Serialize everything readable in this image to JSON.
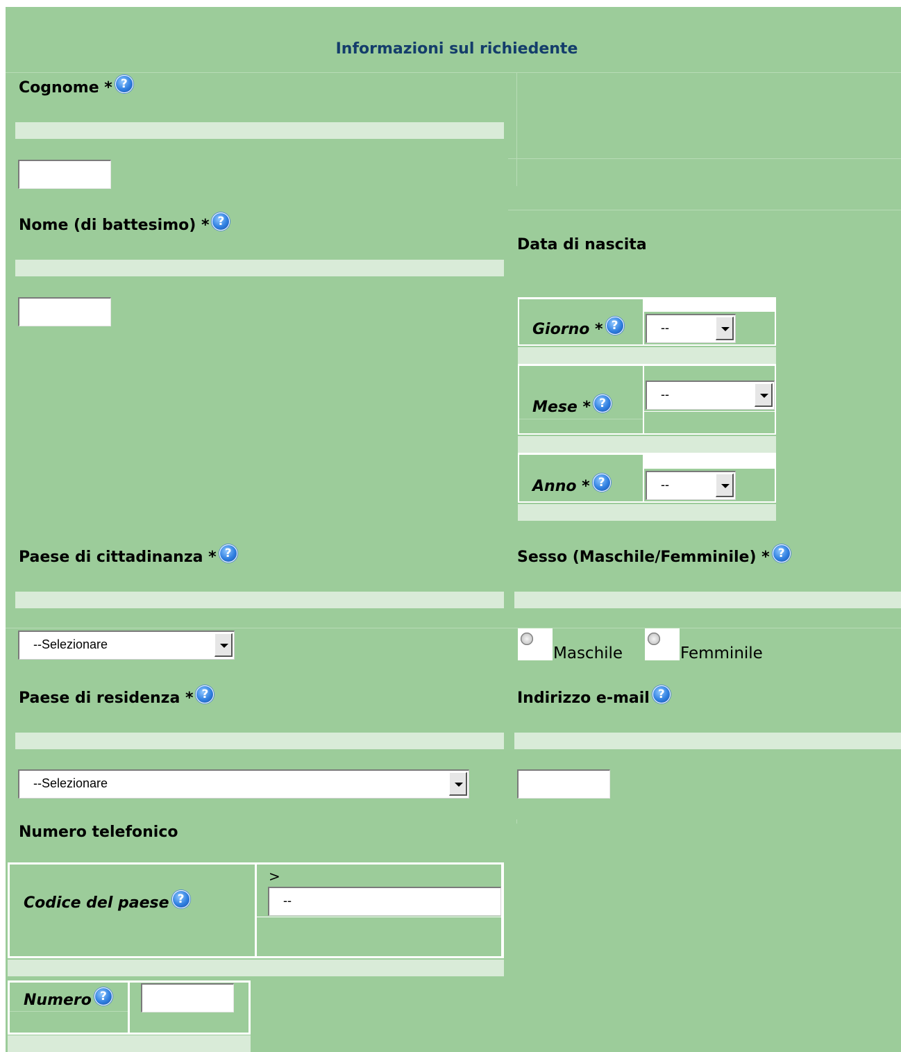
{
  "title": "Informazioni sul richiedente",
  "help_glyph": "?",
  "fields": {
    "cognome": {
      "label": "Cognome *",
      "value": ""
    },
    "nome": {
      "label": "Nome (di battesimo) *",
      "value": ""
    },
    "data_nascita": {
      "label": "Data di nascita",
      "giorno": {
        "label": "Giorno *",
        "value": "--"
      },
      "mese": {
        "label": "Mese *",
        "value": "--"
      },
      "anno": {
        "label": "Anno *",
        "value": "--"
      }
    },
    "cittadinanza": {
      "label": "Paese di cittadinanza *",
      "value": "--Selezionare"
    },
    "sesso": {
      "label": "Sesso (Maschile/Femminile) *",
      "options": [
        "Maschile",
        "Femminile"
      ]
    },
    "residenza": {
      "label": "Paese di residenza *",
      "value": "--Selezionare"
    },
    "email": {
      "label": "Indirizzo e-mail",
      "value": ""
    },
    "telefono": {
      "label": "Numero telefonico",
      "codice": {
        "label": "Codice del paese",
        "prefix": ">",
        "value": "--"
      },
      "numero": {
        "label": "Numero",
        "value": ""
      }
    }
  }
}
